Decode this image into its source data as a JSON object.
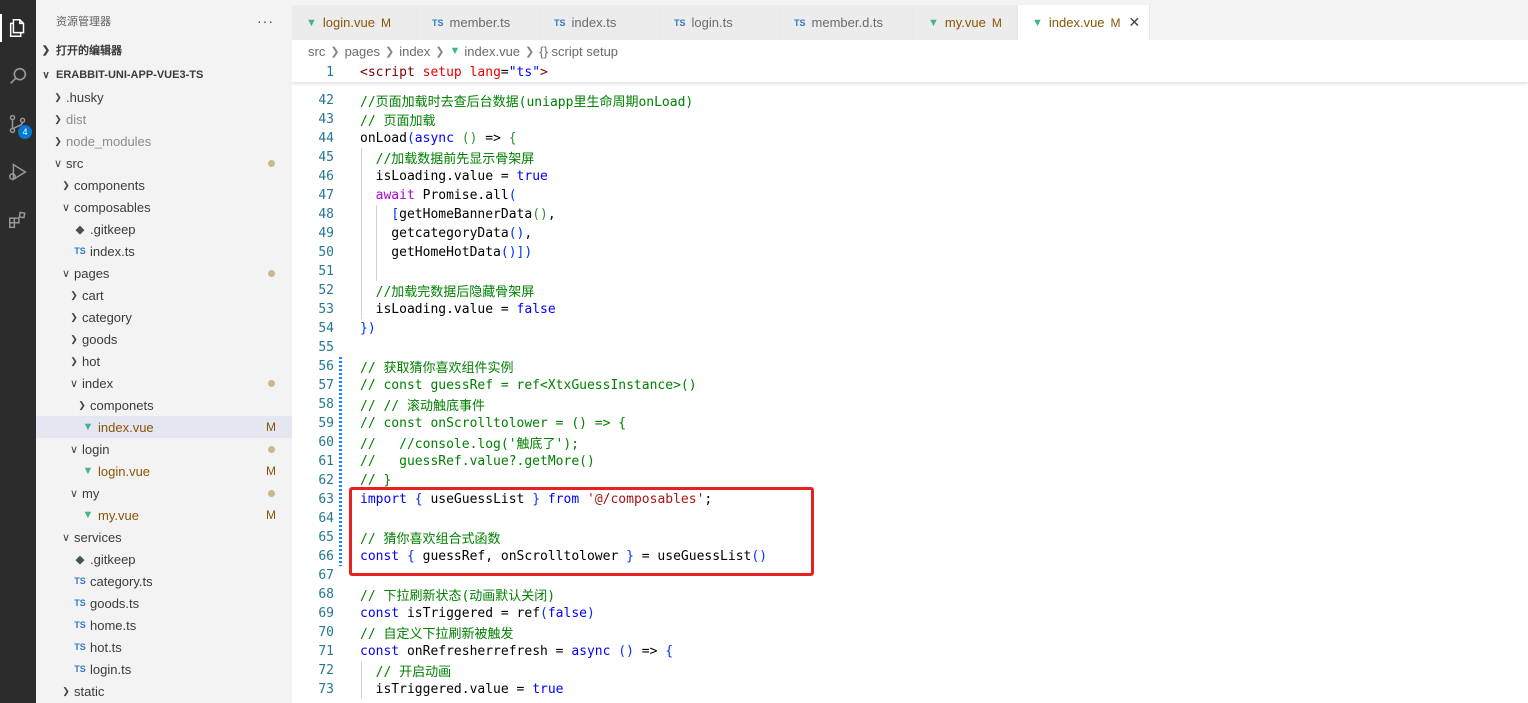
{
  "activity_bar": {
    "icons": [
      "explorer-icon",
      "search-icon",
      "source-control-icon",
      "run-debug-icon",
      "extensions-icon"
    ],
    "source_control_badge": "4"
  },
  "sidebar": {
    "title": "资源管理器",
    "more": "···",
    "open_editors": "打开的编辑器",
    "project": "ERABBIT-UNI-APP-VUE3-TS",
    "tree": [
      {
        "label": "husky",
        "prefix": ".",
        "type": "folder"
      },
      {
        "label": "dist",
        "type": "folder",
        "dim": true
      },
      {
        "label": "node_modules",
        "type": "folder",
        "dim": true
      },
      {
        "label": "src",
        "type": "folder-open"
      },
      {
        "label": "components",
        "type": "folder"
      },
      {
        "label": "composables",
        "type": "folder-open"
      },
      {
        "label": ".gitkeep",
        "type": "git"
      },
      {
        "label": "index.ts",
        "type": "ts"
      },
      {
        "label": "pages",
        "type": "folder-open"
      },
      {
        "label": "cart",
        "type": "folder"
      },
      {
        "label": "category",
        "type": "folder"
      },
      {
        "label": "goods",
        "type": "folder"
      },
      {
        "label": "hot",
        "type": "folder"
      },
      {
        "label": "index",
        "type": "folder-open"
      },
      {
        "label": "componets",
        "type": "folder"
      },
      {
        "label": "index.vue",
        "type": "vue",
        "mark": "M"
      },
      {
        "label": "login",
        "type": "folder-open"
      },
      {
        "label": "login.vue",
        "type": "vue",
        "mark": "M"
      },
      {
        "label": "my",
        "type": "folder-open"
      },
      {
        "label": "my.vue",
        "type": "vue",
        "mark": "M"
      },
      {
        "label": "services",
        "type": "folder-open"
      },
      {
        "label": ".gitkeep",
        "type": "git"
      },
      {
        "label": "category.ts",
        "type": "ts"
      },
      {
        "label": "goods.ts",
        "type": "ts"
      },
      {
        "label": "home.ts",
        "type": "ts"
      },
      {
        "label": "hot.ts",
        "type": "ts"
      },
      {
        "label": "login.ts",
        "type": "ts"
      },
      {
        "label": "static",
        "type": "folder"
      }
    ]
  },
  "tabs": [
    {
      "label": "login.vue",
      "type": "vue",
      "mark": "M"
    },
    {
      "label": "member.ts",
      "type": "ts"
    },
    {
      "label": "index.ts",
      "type": "ts"
    },
    {
      "label": "login.ts",
      "type": "ts"
    },
    {
      "label": "member.d.ts",
      "type": "ts"
    },
    {
      "label": "my.vue",
      "type": "vue",
      "mark": "M"
    },
    {
      "label": "index.vue",
      "type": "vue",
      "mark": "M",
      "active": true
    }
  ],
  "breadcrumb": {
    "parts": [
      "src",
      "pages",
      "index",
      "index.vue",
      "{} script setup"
    ]
  },
  "editor": {
    "sticky": {
      "num": "1",
      "code": "<script setup lang=\"ts\">"
    },
    "lines": [
      {
        "num": "42",
        "code": "//页面加载时去查后台数据(uniapp里生命周期onLoad)"
      },
      {
        "num": "43",
        "code": "// 页面加载"
      },
      {
        "num": "44",
        "code": "onLoad(async () => {"
      },
      {
        "num": "45",
        "code": "  //加载数据前先显示骨架屏"
      },
      {
        "num": "46",
        "code": "  isLoading.value = true"
      },
      {
        "num": "47",
        "code": "  await Promise.all("
      },
      {
        "num": "48",
        "code": "    [getHomeBannerData(),"
      },
      {
        "num": "49",
        "code": "    getcategoryData(),"
      },
      {
        "num": "50",
        "code": "    getHomeHotData()])"
      },
      {
        "num": "51",
        "code": ""
      },
      {
        "num": "52",
        "code": "  //加载完数据后隐藏骨架屏"
      },
      {
        "num": "53",
        "code": "  isLoading.value = false"
      },
      {
        "num": "54",
        "code": "})"
      },
      {
        "num": "55",
        "code": ""
      },
      {
        "num": "56",
        "code": "// 获取猜你喜欢组件实例"
      },
      {
        "num": "57",
        "code": "// const guessRef = ref<XtxGuessInstance>()"
      },
      {
        "num": "58",
        "code": "// // 滚动触底事件"
      },
      {
        "num": "59",
        "code": "// const onScrolltolower = () => {"
      },
      {
        "num": "60",
        "code": "//   //console.log('触底了');"
      },
      {
        "num": "61",
        "code": "//   guessRef.value?.getMore()"
      },
      {
        "num": "62",
        "code": "// }"
      },
      {
        "num": "63",
        "code": "import { useGuessList } from '@/composables';"
      },
      {
        "num": "64",
        "code": ""
      },
      {
        "num": "65",
        "code": "// 猜你喜欢组合式函数"
      },
      {
        "num": "66",
        "code": "const { guessRef, onScrolltolower } = useGuessList()"
      },
      {
        "num": "67",
        "code": ""
      },
      {
        "num": "68",
        "code": "// 下拉刷新状态(动画默认关闭)"
      },
      {
        "num": "69",
        "code": "const isTriggered = ref(false)"
      },
      {
        "num": "70",
        "code": "// 自定义下拉刷新被触发"
      },
      {
        "num": "71",
        "code": "const onRefresherrefresh = async () => {"
      },
      {
        "num": "72",
        "code": "  // 开启动画"
      },
      {
        "num": "73",
        "code": "  isTriggered.value = true"
      }
    ]
  }
}
